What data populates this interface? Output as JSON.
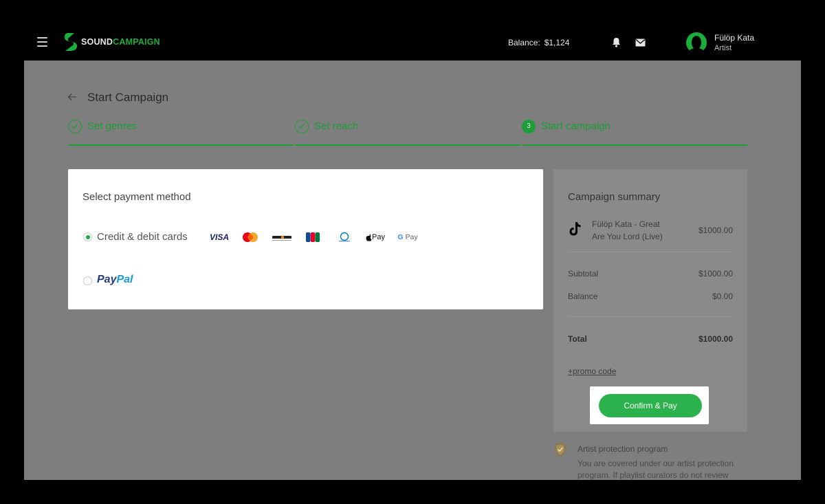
{
  "header": {
    "logo": {
      "part1": "SOUND",
      "part2": "CAMPAIGN"
    },
    "balance_label": "Balance:",
    "balance_value": "$1,124",
    "user": {
      "name": "Fülöp Kata",
      "role": "Artist"
    }
  },
  "page": {
    "title": "Start Campaign",
    "steps": [
      {
        "label": "Set genres",
        "state": "done"
      },
      {
        "label": "Set reach",
        "state": "done"
      },
      {
        "number": "3",
        "label": "Start campaign",
        "state": "current"
      }
    ]
  },
  "payment": {
    "title": "Select payment method",
    "options": [
      {
        "label": "Credit & debit cards",
        "selected": true
      },
      {
        "brand_part1": "Pay",
        "brand_part2": "Pal",
        "selected": false
      }
    ],
    "card_logos": [
      "visa-logo",
      "mastercard-logo",
      "discover-logo",
      "jcb-logo",
      "diners-club-logo",
      "apple-pay-logo",
      "google-pay-logo"
    ],
    "visa_text": "VISA",
    "apple_pay_text": "Pay",
    "google_pay_g": "G",
    "google_pay_text": "Pay"
  },
  "summary": {
    "title": "Campaign summary",
    "item": {
      "name": "Fülöp Kata - Great Are You Lord (Live)",
      "price": "$1000.00"
    },
    "subtotal_label": "Subtotal",
    "subtotal_value": "$1000.00",
    "balance_label": "Balance",
    "balance_value": "$0.00",
    "total_label": "Total",
    "total_value": "$1000.00",
    "promo_label": "+promo code",
    "confirm_label": "Confirm & Pay"
  },
  "protection": {
    "title": "Artist protection program",
    "text": "You are covered under our artist protection program. If playlist curators do not review"
  },
  "colors": {
    "accent": "#1cae3a",
    "button": "#2bb24c",
    "overlay": "#7e7e7e"
  }
}
